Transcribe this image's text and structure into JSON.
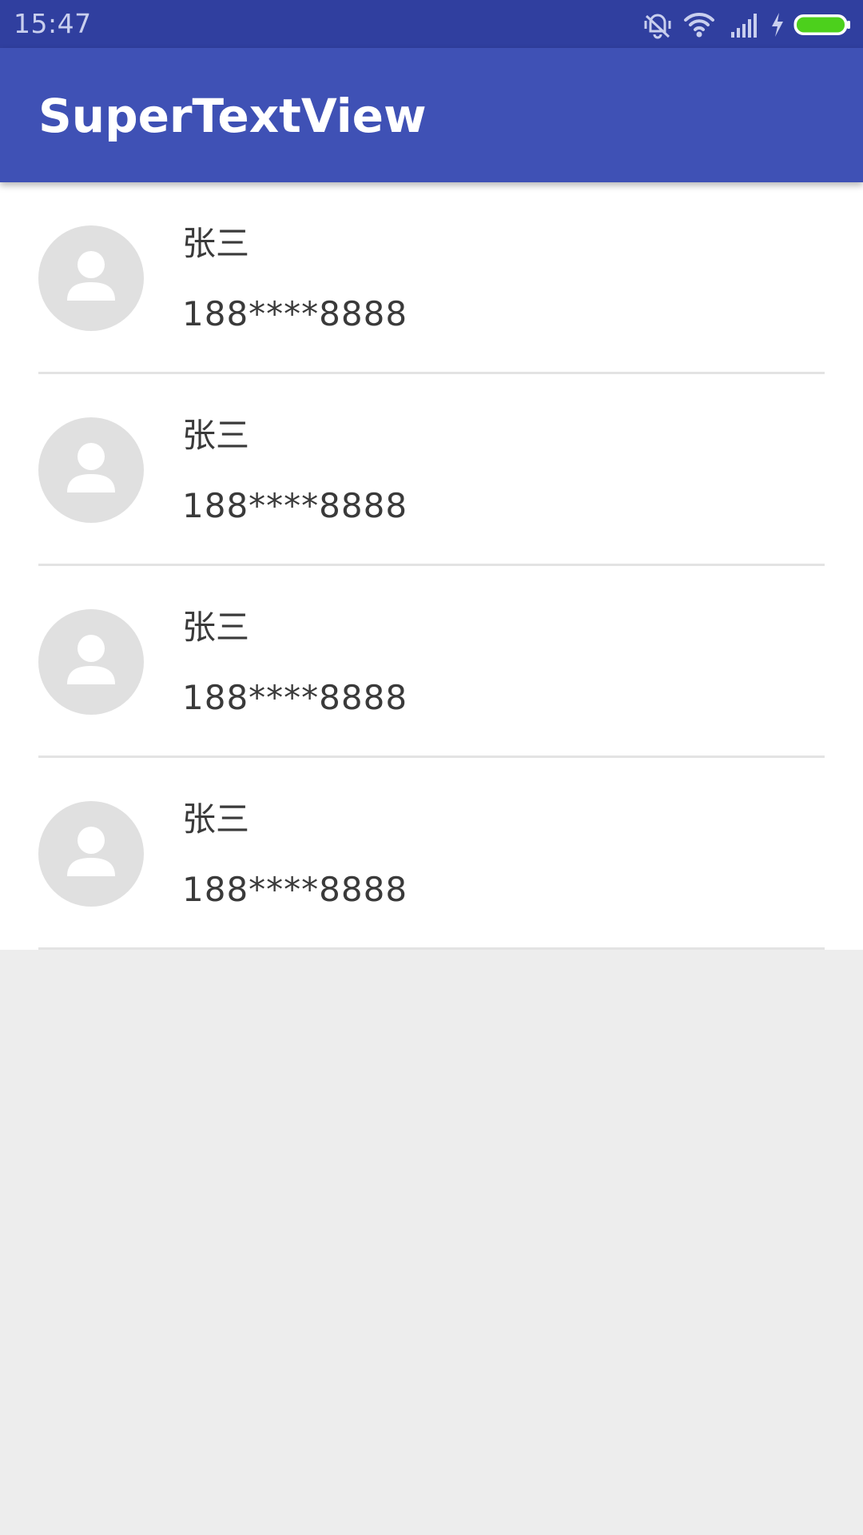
{
  "status_bar": {
    "time": "15:47",
    "icons": [
      "vibrate-icon",
      "wifi-icon",
      "signal-icon",
      "charging-icon",
      "battery-icon"
    ],
    "battery_color": "#4CD01C"
  },
  "app_bar": {
    "title": "SuperTextView",
    "color": "#3F51B5"
  },
  "contacts": [
    {
      "name": "张三",
      "phone": "188****8888",
      "icon": "person-icon"
    },
    {
      "name": "张三",
      "phone": "188****8888",
      "icon": "person-icon"
    },
    {
      "name": "张三",
      "phone": "188****8888",
      "icon": "person-icon"
    },
    {
      "name": "张三",
      "phone": "188****8888",
      "icon": "person-icon"
    }
  ]
}
